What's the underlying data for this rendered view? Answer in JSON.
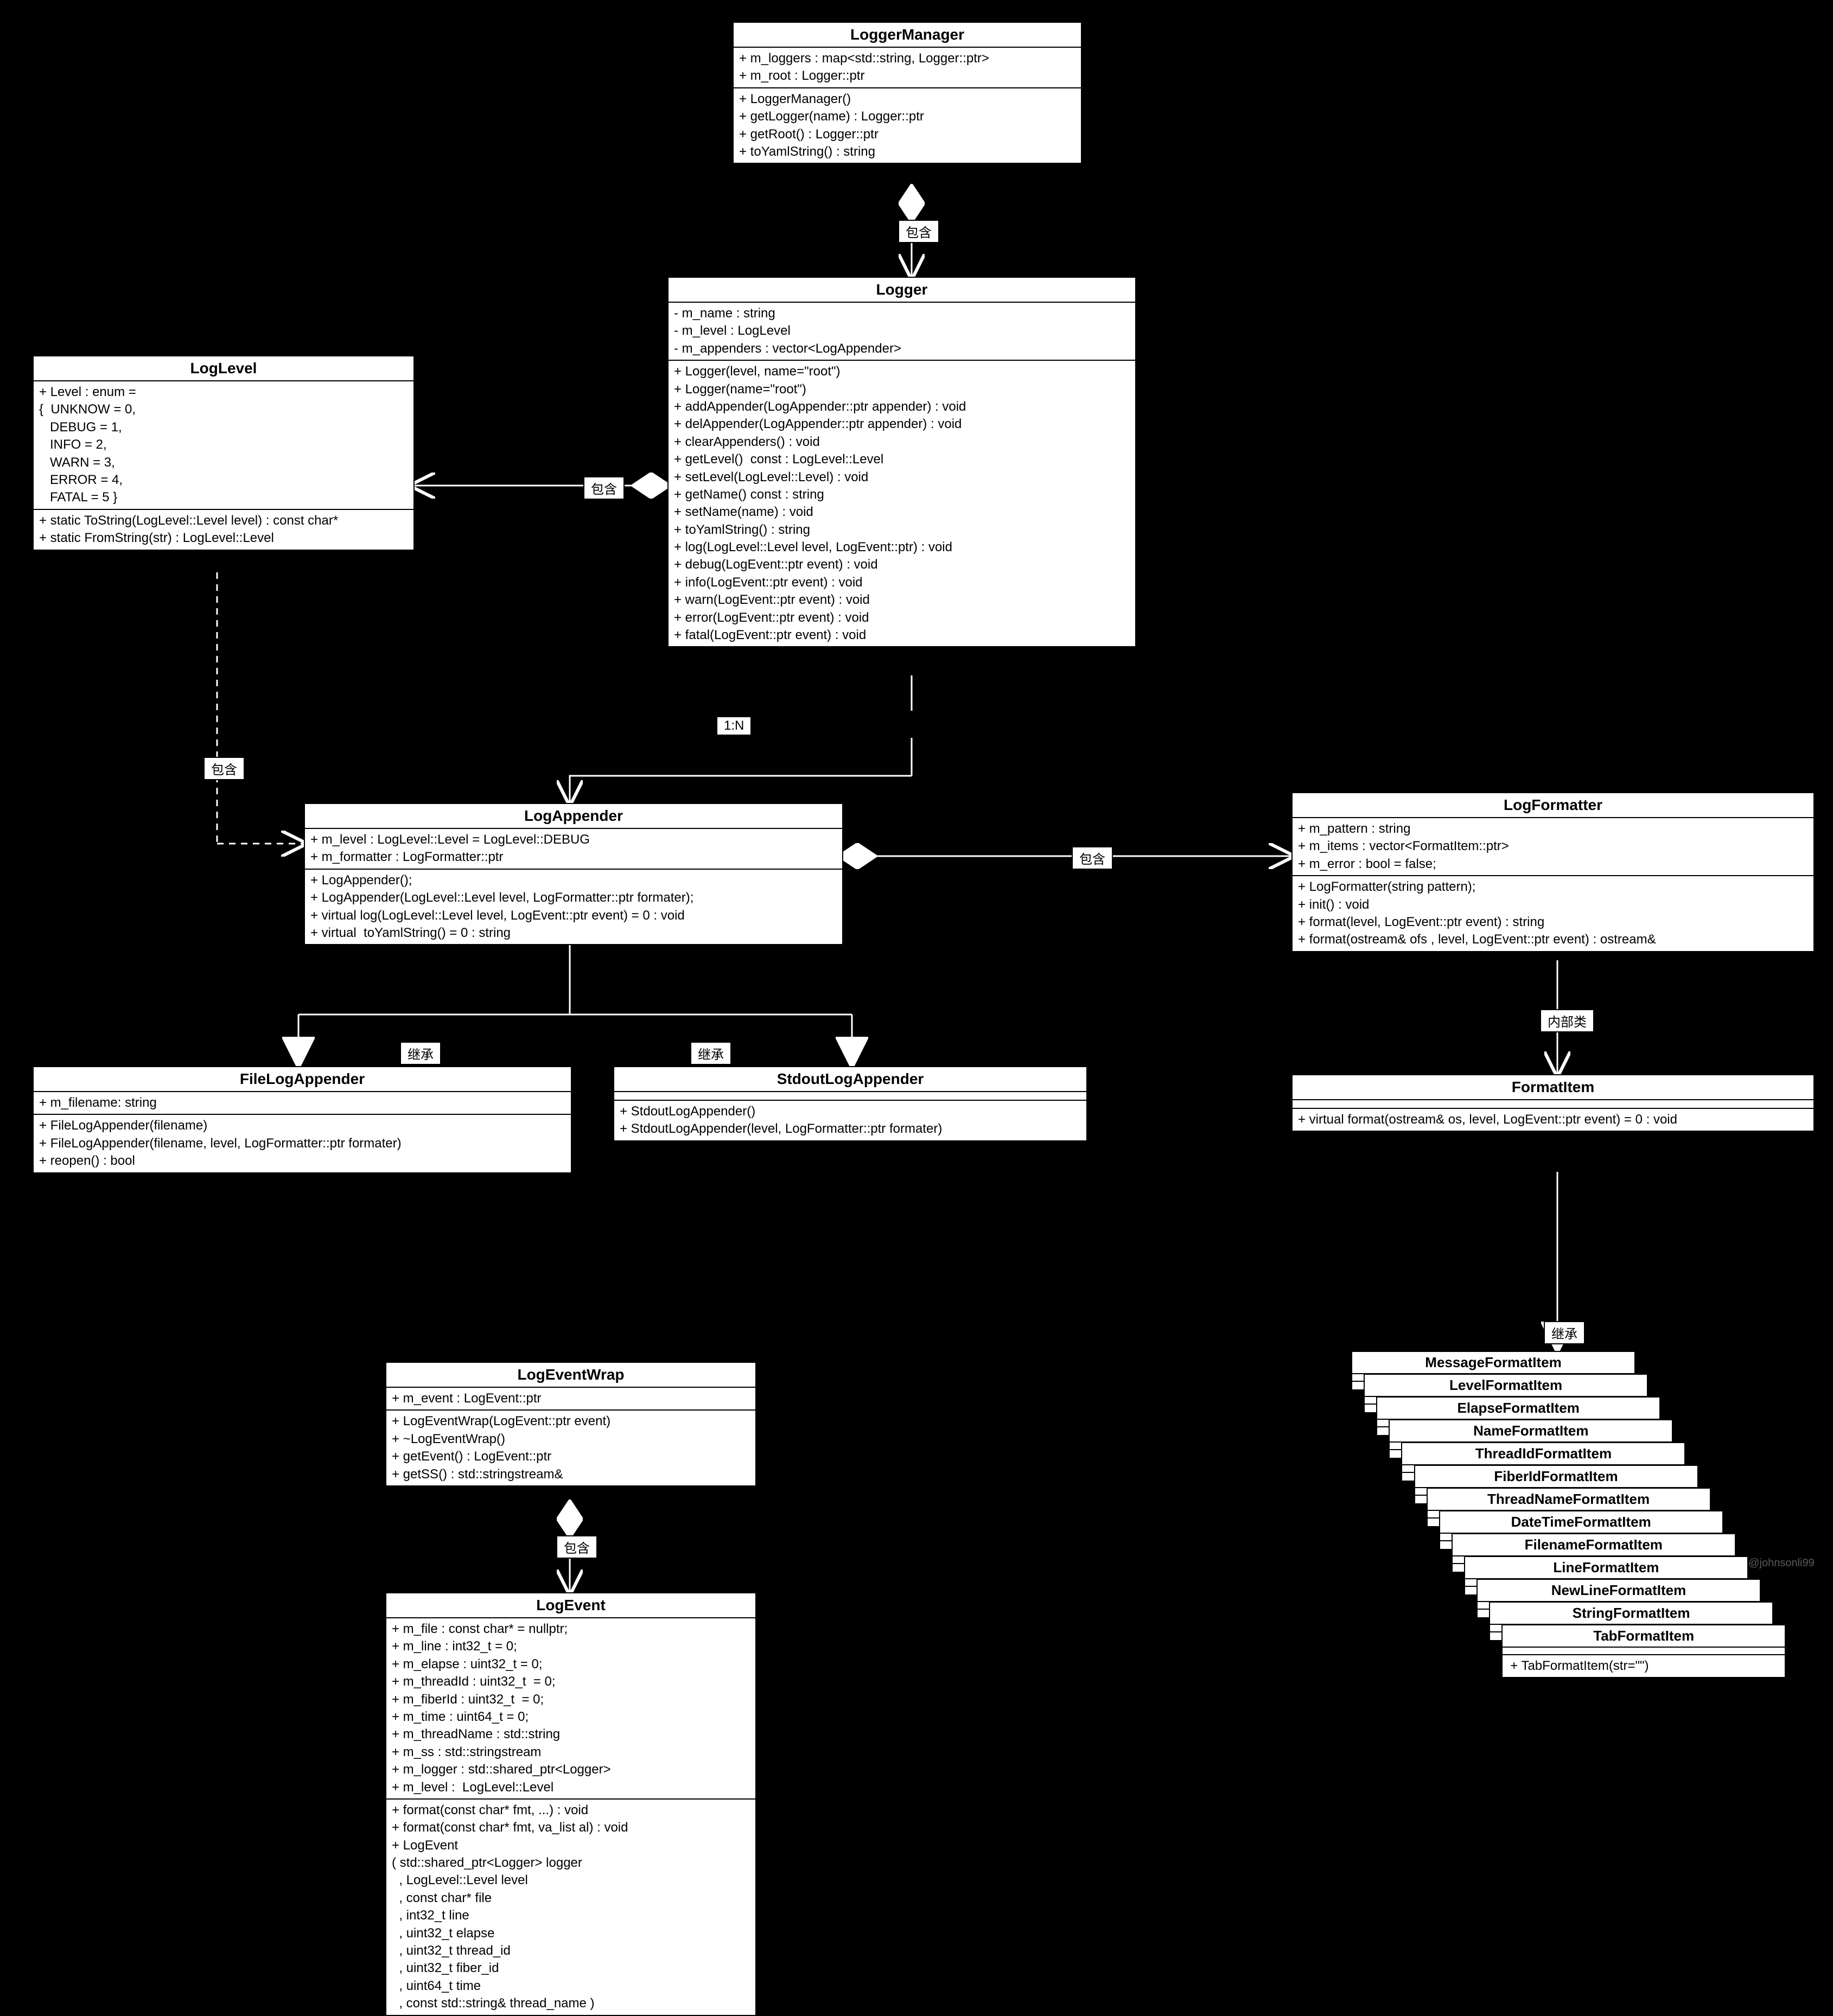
{
  "labels": {
    "contain_lm_l": "包含",
    "contain_l_la": "包含",
    "contain_la_lf": "包含",
    "contain_lew_le": "包含",
    "inherit_fla": "继承",
    "inherit_sla": "继承",
    "inherit_fi": "继承",
    "inner_class": "内部类",
    "one_n": "1:N",
    "contain_ll_l": "包含"
  },
  "classes": {
    "LoggerManager": {
      "title": "LoggerManager",
      "attrs": "+ m_loggers : map<std::string, Logger::ptr>\n+ m_root : Logger::ptr",
      "ops": "+ LoggerManager()\n+ getLogger(name) : Logger::ptr\n+ getRoot() : Logger::ptr\n+ toYamlString() : string"
    },
    "LogLevel": {
      "title": "LogLevel",
      "attrs": "+ Level : enum =\n{  UNKNOW = 0,\n   DEBUG = 1,\n   INFO = 2,\n   WARN = 3,\n   ERROR = 4,\n   FATAL = 5 }",
      "ops": "+ static ToString(LogLevel::Level level) : const char*\n+ static FromString(str) : LogLevel::Level"
    },
    "Logger": {
      "title": "Logger",
      "attrs": "- m_name : string\n- m_level : LogLevel\n- m_appenders : vector<LogAppender>",
      "ops": "+ Logger(level, name=\"root\")\n+ Logger(name=\"root\")\n+ addAppender(LogAppender::ptr appender) : void\n+ delAppender(LogAppender::ptr appender) : void\n+ clearAppenders() : void\n+ getLevel()  const : LogLevel::Level\n+ setLevel(LogLevel::Level) : void\n+ getName() const : string\n+ setName(name) : void\n+ toYamlString() : string\n+ log(LogLevel::Level level, LogEvent::ptr) : void\n+ debug(LogEvent::ptr event) : void\n+ info(LogEvent::ptr event) : void\n+ warn(LogEvent::ptr event) : void\n+ error(LogEvent::ptr event) : void\n+ fatal(LogEvent::ptr event) : void"
    },
    "LogAppender": {
      "title": "LogAppender",
      "attrs": "+ m_level : LogLevel::Level = LogLevel::DEBUG\n+ m_formatter : LogFormatter::ptr",
      "ops": "+ LogAppender();\n+ LogAppender(LogLevel::Level level, LogFormatter::ptr formater);\n+ virtual log(LogLevel::Level level, LogEvent::ptr event) = 0 : void\n+ virtual  toYamlString() = 0 : string"
    },
    "FileLogAppender": {
      "title": "FileLogAppender",
      "attrs": "+ m_filename: string",
      "ops": "+ FileLogAppender(filename)\n+ FileLogAppender(filename, level, LogFormatter::ptr formater)\n+ reopen() : bool"
    },
    "StdoutLogAppender": {
      "title": "StdoutLogAppender",
      "attrs": "",
      "ops": "+ StdoutLogAppender()\n+ StdoutLogAppender(level, LogFormatter::ptr formater)"
    },
    "LogFormatter": {
      "title": "LogFormatter",
      "attrs": "+ m_pattern : string\n+ m_items : vector<FormatItem::ptr>\n+ m_error : bool = false;",
      "ops": "+ LogFormatter(string pattern);\n+ init() : void\n+ format(level, LogEvent::ptr event) : string\n+ format(ostream& ofs , level, LogEvent::ptr event) : ostream&"
    },
    "FormatItem": {
      "title": "FormatItem",
      "attrs": "",
      "ops": "+ virtual format(ostream& os, level, LogEvent::ptr event) = 0 : void"
    },
    "LogEventWrap": {
      "title": "LogEventWrap",
      "attrs": "+ m_event : LogEvent::ptr",
      "ops": "+ LogEventWrap(LogEvent::ptr event)\n+ ~LogEventWrap()\n+ getEvent() : LogEvent::ptr\n+ getSS() : std::stringstream&"
    },
    "LogEvent": {
      "title": "LogEvent",
      "attrs": "+ m_file : const char* = nullptr;\n+ m_line : int32_t = 0;\n+ m_elapse : uint32_t = 0;\n+ m_threadId : uint32_t  = 0;\n+ m_fiberId : uint32_t  = 0;\n+ m_time : uint64_t = 0;\n+ m_threadName : std::string\n+ m_ss : std::stringstream\n+ m_logger : std::shared_ptr<Logger>\n+ m_level :  LogLevel::Level",
      "ops": "+ format(const char* fmt, ...) : void\n+ format(const char* fmt, va_list al) : void\n+ LogEvent\n( std::shared_ptr<Logger> logger\n  , LogLevel::Level level\n  , const char* file\n  , int32_t line\n  , uint32_t elapse\n  , uint32_t thread_id\n  , uint32_t fiber_id\n  , uint64_t time\n  , const std::string& thread_name )"
    }
  },
  "formatItems": [
    "MessageFormatItem",
    "LevelFormatItem",
    "ElapseFormatItem",
    "NameFormatItem",
    "ThreadIdFormatItem",
    "FiberIdFormatItem",
    "ThreadNameFormatItem",
    "DateTimeFormatItem",
    "FilenameFormatItem",
    "LineFormatItem",
    "NewLineFormatItem",
    "StringFormatItem",
    "TabFormatItem"
  ],
  "tabFormatOp": "+ TabFormatItem(str=\"\")",
  "watermark": "CSDN @johnsonli99"
}
